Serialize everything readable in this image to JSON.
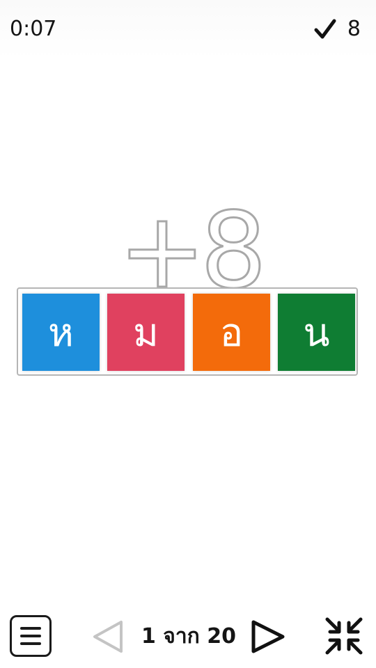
{
  "status": {
    "timer": "0:07",
    "score": "8"
  },
  "bonus": {
    "text": "+8"
  },
  "tiles": [
    {
      "letter": "ห",
      "color": "#1e8fdc"
    },
    {
      "letter": "ม",
      "color": "#e0415f"
    },
    {
      "letter": "อ",
      "color": "#f36b0b"
    },
    {
      "letter": "น",
      "color": "#0f7d33"
    }
  ],
  "navigation": {
    "page_label": "1 จาก 20"
  },
  "icons": {
    "menu": "hamburger-icon",
    "prev": "triangle-left-outline-icon",
    "next": "triangle-right-outline-icon",
    "shrink": "collapse-arrows-icon",
    "check": "checkmark-icon"
  }
}
